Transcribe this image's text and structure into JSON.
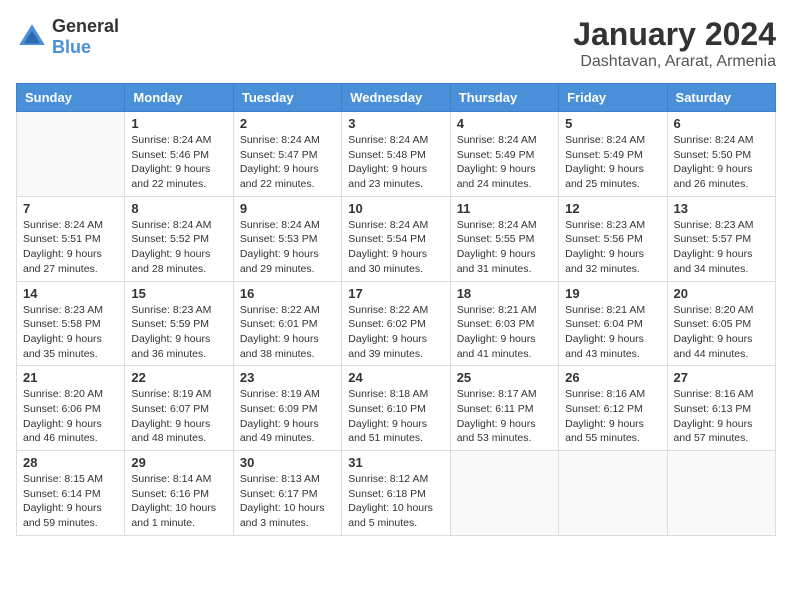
{
  "logo": {
    "general": "General",
    "blue": "Blue"
  },
  "title": "January 2024",
  "location": "Dashtavan, Ararat, Armenia",
  "days_of_week": [
    "Sunday",
    "Monday",
    "Tuesday",
    "Wednesday",
    "Thursday",
    "Friday",
    "Saturday"
  ],
  "weeks": [
    [
      {
        "day": "",
        "sunrise": "",
        "sunset": "",
        "daylight": ""
      },
      {
        "day": "1",
        "sunrise": "Sunrise: 8:24 AM",
        "sunset": "Sunset: 5:46 PM",
        "daylight": "Daylight: 9 hours and 22 minutes."
      },
      {
        "day": "2",
        "sunrise": "Sunrise: 8:24 AM",
        "sunset": "Sunset: 5:47 PM",
        "daylight": "Daylight: 9 hours and 22 minutes."
      },
      {
        "day": "3",
        "sunrise": "Sunrise: 8:24 AM",
        "sunset": "Sunset: 5:48 PM",
        "daylight": "Daylight: 9 hours and 23 minutes."
      },
      {
        "day": "4",
        "sunrise": "Sunrise: 8:24 AM",
        "sunset": "Sunset: 5:49 PM",
        "daylight": "Daylight: 9 hours and 24 minutes."
      },
      {
        "day": "5",
        "sunrise": "Sunrise: 8:24 AM",
        "sunset": "Sunset: 5:49 PM",
        "daylight": "Daylight: 9 hours and 25 minutes."
      },
      {
        "day": "6",
        "sunrise": "Sunrise: 8:24 AM",
        "sunset": "Sunset: 5:50 PM",
        "daylight": "Daylight: 9 hours and 26 minutes."
      }
    ],
    [
      {
        "day": "7",
        "sunrise": "Sunrise: 8:24 AM",
        "sunset": "Sunset: 5:51 PM",
        "daylight": "Daylight: 9 hours and 27 minutes."
      },
      {
        "day": "8",
        "sunrise": "Sunrise: 8:24 AM",
        "sunset": "Sunset: 5:52 PM",
        "daylight": "Daylight: 9 hours and 28 minutes."
      },
      {
        "day": "9",
        "sunrise": "Sunrise: 8:24 AM",
        "sunset": "Sunset: 5:53 PM",
        "daylight": "Daylight: 9 hours and 29 minutes."
      },
      {
        "day": "10",
        "sunrise": "Sunrise: 8:24 AM",
        "sunset": "Sunset: 5:54 PM",
        "daylight": "Daylight: 9 hours and 30 minutes."
      },
      {
        "day": "11",
        "sunrise": "Sunrise: 8:24 AM",
        "sunset": "Sunset: 5:55 PM",
        "daylight": "Daylight: 9 hours and 31 minutes."
      },
      {
        "day": "12",
        "sunrise": "Sunrise: 8:23 AM",
        "sunset": "Sunset: 5:56 PM",
        "daylight": "Daylight: 9 hours and 32 minutes."
      },
      {
        "day": "13",
        "sunrise": "Sunrise: 8:23 AM",
        "sunset": "Sunset: 5:57 PM",
        "daylight": "Daylight: 9 hours and 34 minutes."
      }
    ],
    [
      {
        "day": "14",
        "sunrise": "Sunrise: 8:23 AM",
        "sunset": "Sunset: 5:58 PM",
        "daylight": "Daylight: 9 hours and 35 minutes."
      },
      {
        "day": "15",
        "sunrise": "Sunrise: 8:23 AM",
        "sunset": "Sunset: 5:59 PM",
        "daylight": "Daylight: 9 hours and 36 minutes."
      },
      {
        "day": "16",
        "sunrise": "Sunrise: 8:22 AM",
        "sunset": "Sunset: 6:01 PM",
        "daylight": "Daylight: 9 hours and 38 minutes."
      },
      {
        "day": "17",
        "sunrise": "Sunrise: 8:22 AM",
        "sunset": "Sunset: 6:02 PM",
        "daylight": "Daylight: 9 hours and 39 minutes."
      },
      {
        "day": "18",
        "sunrise": "Sunrise: 8:21 AM",
        "sunset": "Sunset: 6:03 PM",
        "daylight": "Daylight: 9 hours and 41 minutes."
      },
      {
        "day": "19",
        "sunrise": "Sunrise: 8:21 AM",
        "sunset": "Sunset: 6:04 PM",
        "daylight": "Daylight: 9 hours and 43 minutes."
      },
      {
        "day": "20",
        "sunrise": "Sunrise: 8:20 AM",
        "sunset": "Sunset: 6:05 PM",
        "daylight": "Daylight: 9 hours and 44 minutes."
      }
    ],
    [
      {
        "day": "21",
        "sunrise": "Sunrise: 8:20 AM",
        "sunset": "Sunset: 6:06 PM",
        "daylight": "Daylight: 9 hours and 46 minutes."
      },
      {
        "day": "22",
        "sunrise": "Sunrise: 8:19 AM",
        "sunset": "Sunset: 6:07 PM",
        "daylight": "Daylight: 9 hours and 48 minutes."
      },
      {
        "day": "23",
        "sunrise": "Sunrise: 8:19 AM",
        "sunset": "Sunset: 6:09 PM",
        "daylight": "Daylight: 9 hours and 49 minutes."
      },
      {
        "day": "24",
        "sunrise": "Sunrise: 8:18 AM",
        "sunset": "Sunset: 6:10 PM",
        "daylight": "Daylight: 9 hours and 51 minutes."
      },
      {
        "day": "25",
        "sunrise": "Sunrise: 8:17 AM",
        "sunset": "Sunset: 6:11 PM",
        "daylight": "Daylight: 9 hours and 53 minutes."
      },
      {
        "day": "26",
        "sunrise": "Sunrise: 8:16 AM",
        "sunset": "Sunset: 6:12 PM",
        "daylight": "Daylight: 9 hours and 55 minutes."
      },
      {
        "day": "27",
        "sunrise": "Sunrise: 8:16 AM",
        "sunset": "Sunset: 6:13 PM",
        "daylight": "Daylight: 9 hours and 57 minutes."
      }
    ],
    [
      {
        "day": "28",
        "sunrise": "Sunrise: 8:15 AM",
        "sunset": "Sunset: 6:14 PM",
        "daylight": "Daylight: 9 hours and 59 minutes."
      },
      {
        "day": "29",
        "sunrise": "Sunrise: 8:14 AM",
        "sunset": "Sunset: 6:16 PM",
        "daylight": "Daylight: 10 hours and 1 minute."
      },
      {
        "day": "30",
        "sunrise": "Sunrise: 8:13 AM",
        "sunset": "Sunset: 6:17 PM",
        "daylight": "Daylight: 10 hours and 3 minutes."
      },
      {
        "day": "31",
        "sunrise": "Sunrise: 8:12 AM",
        "sunset": "Sunset: 6:18 PM",
        "daylight": "Daylight: 10 hours and 5 minutes."
      },
      {
        "day": "",
        "sunrise": "",
        "sunset": "",
        "daylight": ""
      },
      {
        "day": "",
        "sunrise": "",
        "sunset": "",
        "daylight": ""
      },
      {
        "day": "",
        "sunrise": "",
        "sunset": "",
        "daylight": ""
      }
    ]
  ]
}
